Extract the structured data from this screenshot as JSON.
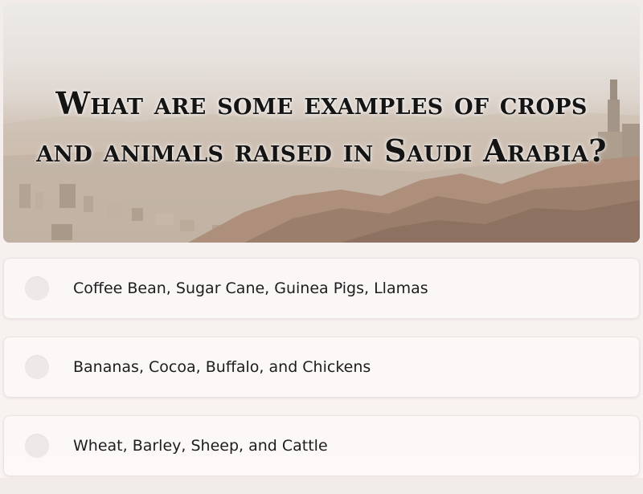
{
  "question": {
    "line1": "What are some examples of crops",
    "line2": "and animals raised in Saudi Arabia?"
  },
  "answers": [
    {
      "label": "Coffee Bean, Sugar Cane, Guinea Pigs, Llamas"
    },
    {
      "label": "Bananas, Cocoa, Buffalo, and Chickens"
    },
    {
      "label": "Wheat, Barley, Sheep, and Cattle"
    }
  ],
  "colors": {
    "background": "#f4eeec",
    "question_text": "#141414",
    "answer_text": "#1d1d1d",
    "radio": "#eee9e8"
  }
}
